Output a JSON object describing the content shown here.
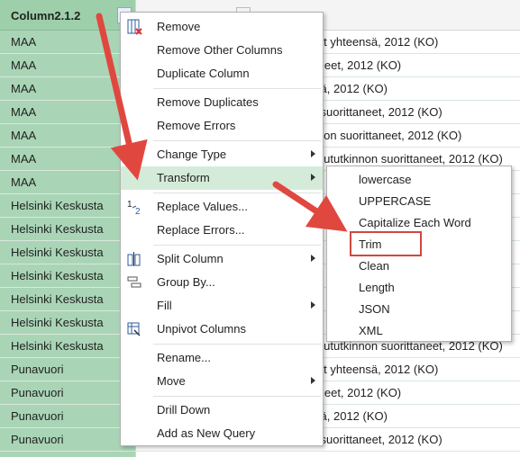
{
  "grid": {
    "column1_header": "Column2.1.2",
    "column2_header": "",
    "rows": [
      {
        "c1": "MAA",
        "c2": "yyttäneet yhteensä, 2012 (KO)"
      },
      {
        "c1": "MAA",
        "c2": "suorittaneet, 2012 (KO)"
      },
      {
        "c1": "MAA",
        "c2": "yhteensä, 2012 (KO)"
      },
      {
        "c1": "MAA",
        "c2": "tkinnon suorittaneet, 2012 (KO)"
      },
      {
        "c1": "MAA",
        "c2": "n tutkinnon suorittaneet, 2012 (KO)"
      },
      {
        "c1": "MAA",
        "c2": "rkeakoulututkinnon suorittaneet, 2012 (KO)"
      },
      {
        "c1": "MAA",
        "c2": ""
      },
      {
        "c1": "Helsinki Keskusta",
        "c2": ""
      },
      {
        "c1": "Helsinki Keskusta",
        "c2": ""
      },
      {
        "c1": "Helsinki Keskusta",
        "c2": ""
      },
      {
        "c1": "Helsinki Keskusta",
        "c2": ""
      },
      {
        "c1": "Helsinki Keskusta",
        "c2": ""
      },
      {
        "c1": "Helsinki Keskusta",
        "c2": ""
      },
      {
        "c1": "Helsinki Keskusta",
        "c2": "rkeakoulututkinnon suorittaneet, 2012 (KO)"
      },
      {
        "c1": "Punavuori",
        "c2": "yyttäneet yhteensä, 2012 (KO)"
      },
      {
        "c1": "Punavuori",
        "c2": "suorittaneet, 2012 (KO)"
      },
      {
        "c1": "Punavuori",
        "c2": "yhteensä, 2012 (KO)"
      },
      {
        "c1": "Punavuori",
        "c2": "tkinnon suorittaneet, 2012 (KO)"
      }
    ]
  },
  "context_menu": {
    "items": [
      {
        "label": "Remove",
        "icon": "remove-column-icon"
      },
      {
        "label": "Remove Other Columns"
      },
      {
        "label": "Duplicate Column"
      },
      {
        "label": "Remove Duplicates"
      },
      {
        "label": "Remove Errors"
      },
      {
        "label": "Change Type",
        "submenu": true
      },
      {
        "label": "Transform",
        "submenu": true,
        "highlighted": true
      },
      {
        "label": "Replace Values...",
        "icon": "replace-values-icon"
      },
      {
        "label": "Replace Errors..."
      },
      {
        "label": "Split Column",
        "submenu": true,
        "icon": "split-column-icon"
      },
      {
        "label": "Group By...",
        "icon": "group-by-icon"
      },
      {
        "label": "Fill",
        "submenu": true
      },
      {
        "label": "Unpivot Columns",
        "icon": "unpivot-icon"
      },
      {
        "label": "Rename..."
      },
      {
        "label": "Move",
        "submenu": true
      },
      {
        "label": "Drill Down"
      },
      {
        "label": "Add as New Query"
      }
    ]
  },
  "transform_submenu": {
    "items": [
      "lowercase",
      "UPPERCASE",
      "Capitalize Each Word",
      "Trim",
      "Clean",
      "Length",
      "JSON",
      "XML"
    ],
    "highlighted_item": "Trim"
  },
  "colors": {
    "column_selected": "#a9d5b6",
    "menu_highlight": "#d5ebd9",
    "annotation_red": "#e0483f"
  }
}
